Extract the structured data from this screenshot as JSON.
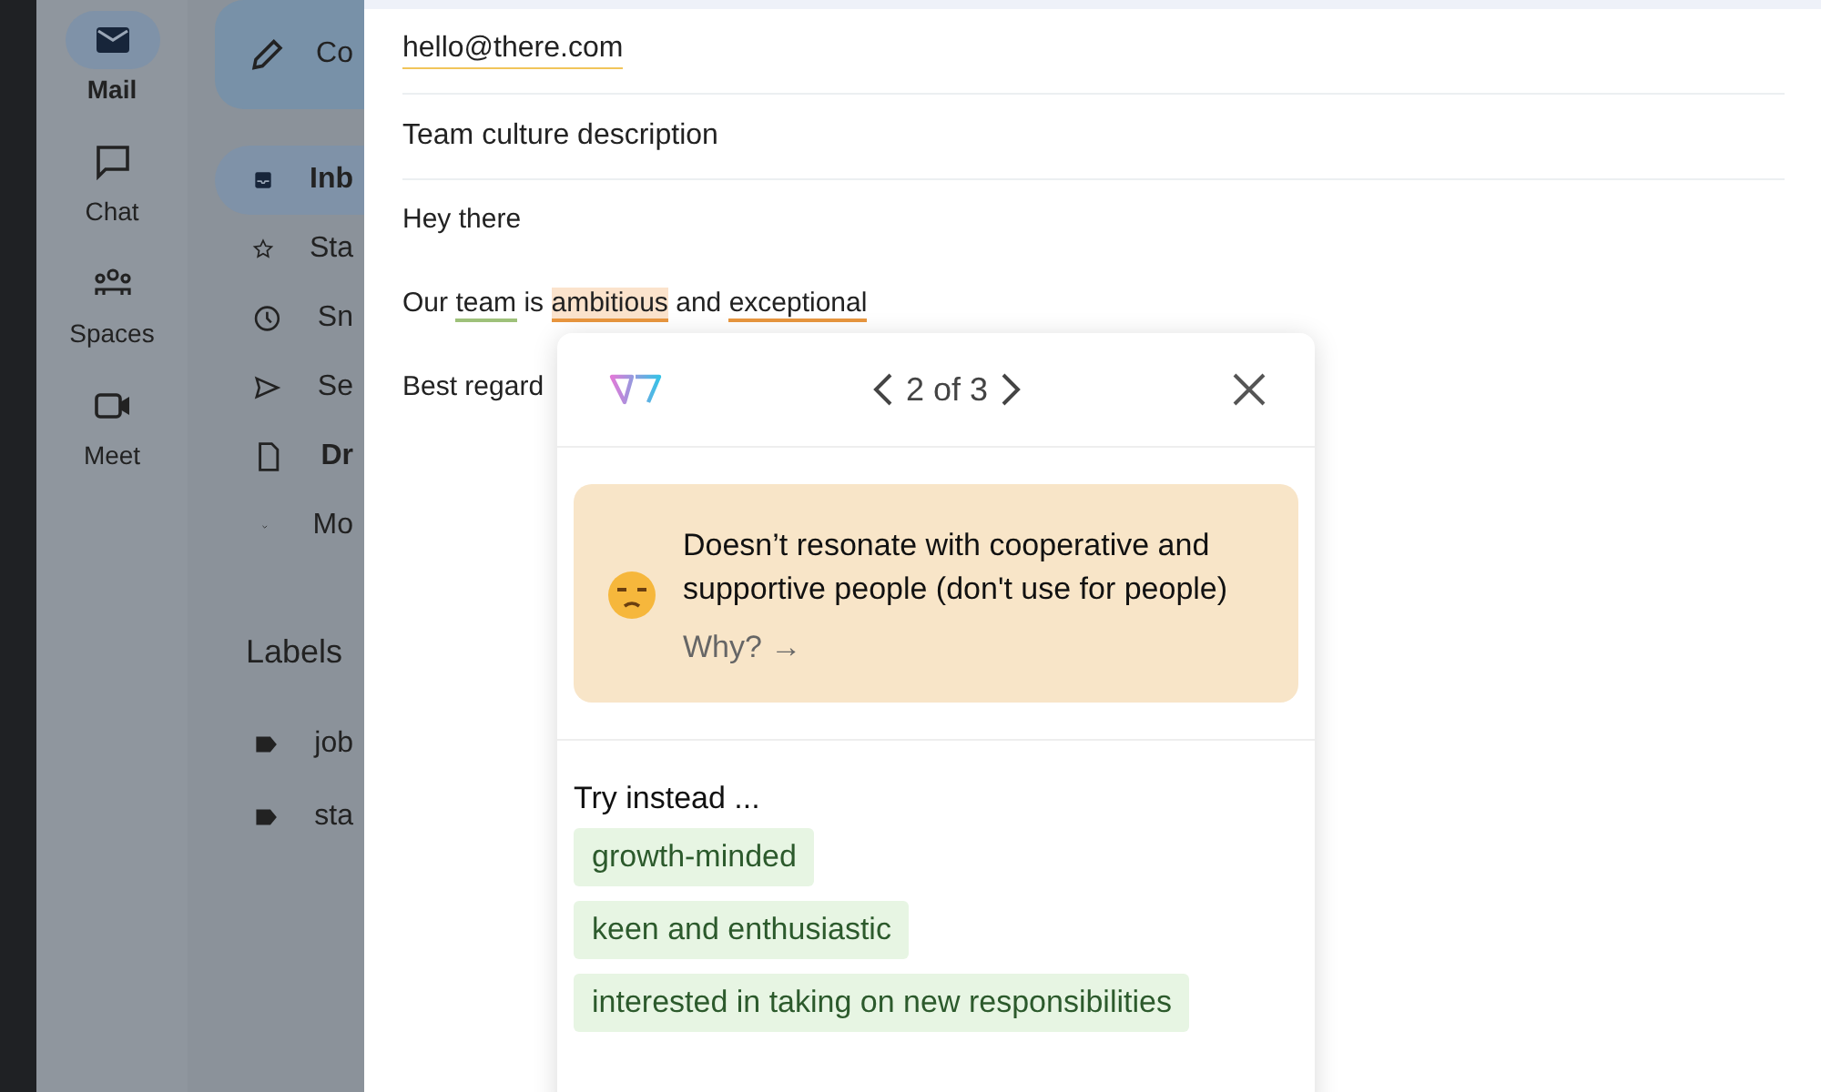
{
  "rail": [
    {
      "label": "Mail",
      "selected": true
    },
    {
      "label": "Chat",
      "selected": false
    },
    {
      "label": "Spaces",
      "selected": false
    },
    {
      "label": "Meet",
      "selected": false
    }
  ],
  "compose_button": "Co",
  "nav": [
    {
      "label": "Inb",
      "selected": true,
      "bold": true
    },
    {
      "label": "Sta",
      "selected": false,
      "bold": false
    },
    {
      "label": "Sn",
      "selected": false,
      "bold": false
    },
    {
      "label": "Se",
      "selected": false,
      "bold": false
    },
    {
      "label": "Dr",
      "selected": false,
      "bold": true
    },
    {
      "label": "Mo",
      "selected": false,
      "bold": false
    }
  ],
  "labels_heading": "Labels",
  "labels": [
    {
      "label": "job"
    },
    {
      "label": "sta"
    }
  ],
  "compose": {
    "to": "hello@there.com",
    "subject": "Team culture description",
    "body": [
      {
        "segments": [
          {
            "text": "Hey there",
            "kind": "plain",
            "selected": false
          }
        ]
      },
      {
        "segments": [
          {
            "text": "Our",
            "kind": "plain",
            "selected": false
          },
          {
            "text": "team",
            "kind": "positive",
            "selected": false
          },
          {
            "text": "is",
            "kind": "plain",
            "selected": false
          },
          {
            "text": "ambitious",
            "kind": "negative",
            "selected": true
          },
          {
            "text": "and",
            "kind": "plain",
            "selected": false
          },
          {
            "text": "exceptional",
            "kind": "negative",
            "selected": false
          }
        ]
      },
      {
        "segments": [
          {
            "text": "Best regard",
            "kind": "plain",
            "selected": false
          }
        ]
      }
    ]
  },
  "popup": {
    "pager": "2 of 3",
    "warning": "Doesn’t resonate with cooperative and supportive people (don't use for people)",
    "why": "Why? →",
    "try_heading": "Try instead ...",
    "suggestions": [
      "growth-minded",
      "keen and enthusiastic",
      "interested in taking on new responsibilities"
    ]
  }
}
